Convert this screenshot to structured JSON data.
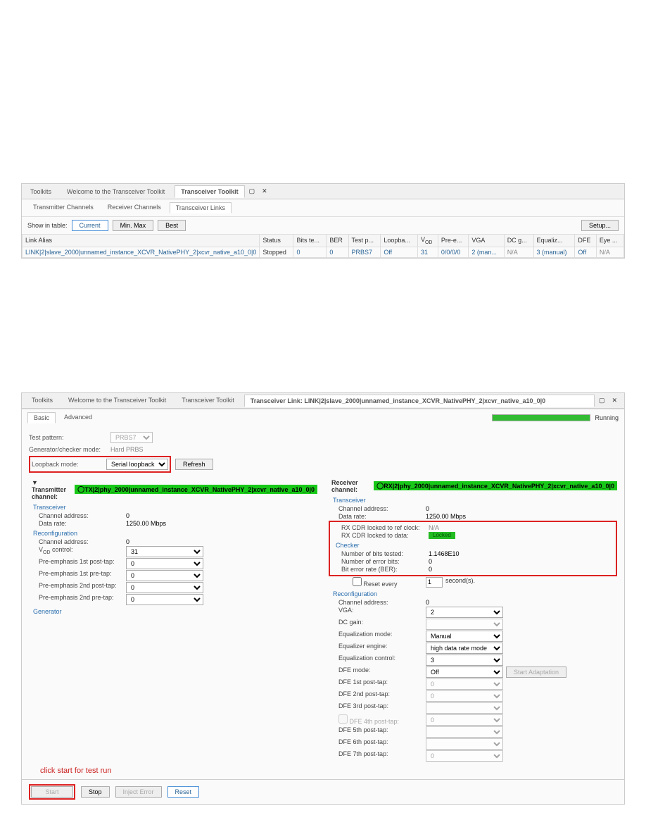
{
  "upper": {
    "tabs": [
      "Toolkits",
      "Welcome to the Transceiver Toolkit",
      "Transceiver Toolkit"
    ],
    "activeTab": "Transceiver Toolkit",
    "subtabs": [
      "Transmitter Channels",
      "Receiver Channels",
      "Transceiver Links"
    ],
    "activeSubtab": "Transceiver Links",
    "showLabel": "Show in table:",
    "btnCurrent": "Current",
    "btnMinMax": "Min. Max",
    "btnBest": "Best",
    "btnSetup": "Setup...",
    "cols": [
      "Link Alias",
      "Status",
      "Bits te...",
      "BER",
      "Test p...",
      "Loopba...",
      "V",
      "Pre-e...",
      "VGA",
      "DC g...",
      "Equaliz...",
      "DFE",
      "Eye ..."
    ],
    "vodSub": "OD",
    "row": {
      "alias": "LINK|2|slave_2000|unnamed_instance_XCVR_NativePHY_2|xcvr_native_a10_0|0",
      "status": "Stopped",
      "bits": "0",
      "ber": "0",
      "testp": "PRBS7",
      "loop": "Off",
      "vod": "31",
      "pre": "0/0/0/0",
      "vga": "2 (man...",
      "dcg": "N/A",
      "equal": "3 (manual)",
      "dfe": "Off",
      "eye": "N/A"
    }
  },
  "lower": {
    "tabs": [
      "Toolkits",
      "Welcome to the Transceiver Toolkit",
      "Transceiver Toolkit"
    ],
    "linkTabTitle": "Transceiver Link: LINK|2|slave_2000|unnamed_instance_XCVR_NativePHY_2|xcvr_native_a10_0|0",
    "running": "Running",
    "basicAdv": [
      "Basic",
      "Advanced"
    ],
    "testPatternL": "Test pattern:",
    "testPatternV": "PRBS7",
    "gencheckL": "Generator/checker mode:",
    "gencheckV": "Hard PRBS",
    "loopbackL": "Loopback mode:",
    "loopbackV": "Serial loopback",
    "refreshBtn": "Refresh",
    "txHead": "Transmitter channel:",
    "txBand": "TX|2|phy_2000|unnamed_instance_XCVR_NativePHY_2|xcvr_native_a10_0|0",
    "rxHead": "Receiver channel:",
    "rxBand": "RX|2|phy_2000|unnamed_instance_XCVR_NativePHY_2|xcvr_native_a10_0|0",
    "tx": {
      "transceiver": "Transceiver",
      "chAddrL": "Channel address:",
      "chAddrV": "0",
      "rateL": "Data rate:",
      "rateV": "1250.00 Mbps",
      "reconfig": "Reconfiguration",
      "reChAddrL": "Channel address:",
      "reChAddrV": "0",
      "vodL": "V",
      "vodSub": "OD",
      "vodSuffix": " control:",
      "vodV": "31",
      "pre1L": "Pre-emphasis 1st post-tap:",
      "pre1V": "0",
      "prepL": "Pre-emphasis 1st pre-tap:",
      "prepV": "0",
      "pre2L": "Pre-emphasis 2nd post-tap:",
      "pre2V": "0",
      "pre2pL": "Pre-emphasis 2nd pre-tap:",
      "pre2pV": "0",
      "gen": "Generator"
    },
    "rx": {
      "transceiver": "Transceiver",
      "chAddrL": "Channel address:",
      "chAddrV": "0",
      "rateL": "Data rate:",
      "rateV": "1250.00 Mbps",
      "cdrRefL": "RX CDR locked to ref clock:",
      "cdrRefV": "N/A",
      "cdrDataL": "RX CDR locked to data:",
      "cdrDataV": "Locked",
      "checker": "Checker",
      "bitsL": "Number of bits tested:",
      "bitsV": "1.1468E10",
      "errL": "Number of error bits:",
      "errV": "0",
      "berL": "Bit error rate (BER):",
      "berV": "0",
      "resetL": "Reset every",
      "resetV": "1",
      "resetUnit": "second(s).",
      "reconfig": "Reconfiguration",
      "reChAddrL": "Channel address:",
      "reChAddrV": "0",
      "vgaL": "VGA:",
      "vgaV": "2",
      "dcgL": "DC gain:",
      "eqmL": "Equalization mode:",
      "eqmV": "Manual",
      "eqeL": "Equalizer engine:",
      "eqeV": "high data rate mode",
      "eqcL": "Equalization control:",
      "eqcV": "3",
      "dfeModeL": "DFE mode:",
      "dfeModeV": "Off",
      "startAdapt": "Start Adaptation",
      "dfe1L": "DFE 1st post-tap:",
      "dfe1V": "0",
      "dfe2L": "DFE 2nd post-tap:",
      "dfe2V": "0",
      "dfe3L": "DFE 3rd post-tap:",
      "dfe4L": "DFE 4th post-tap:",
      "dfe4V": "0",
      "dfe5L": "DFE 5th post-tap:",
      "dfe6L": "DFE 6th post-tap:",
      "dfe7L": "DFE 7th post-tap:",
      "dfe7V": "0"
    },
    "note": "click start for test run",
    "btnStart": "Start",
    "btnStop": "Stop",
    "btnInject": "Inject Error",
    "btnReset": "Reset"
  }
}
